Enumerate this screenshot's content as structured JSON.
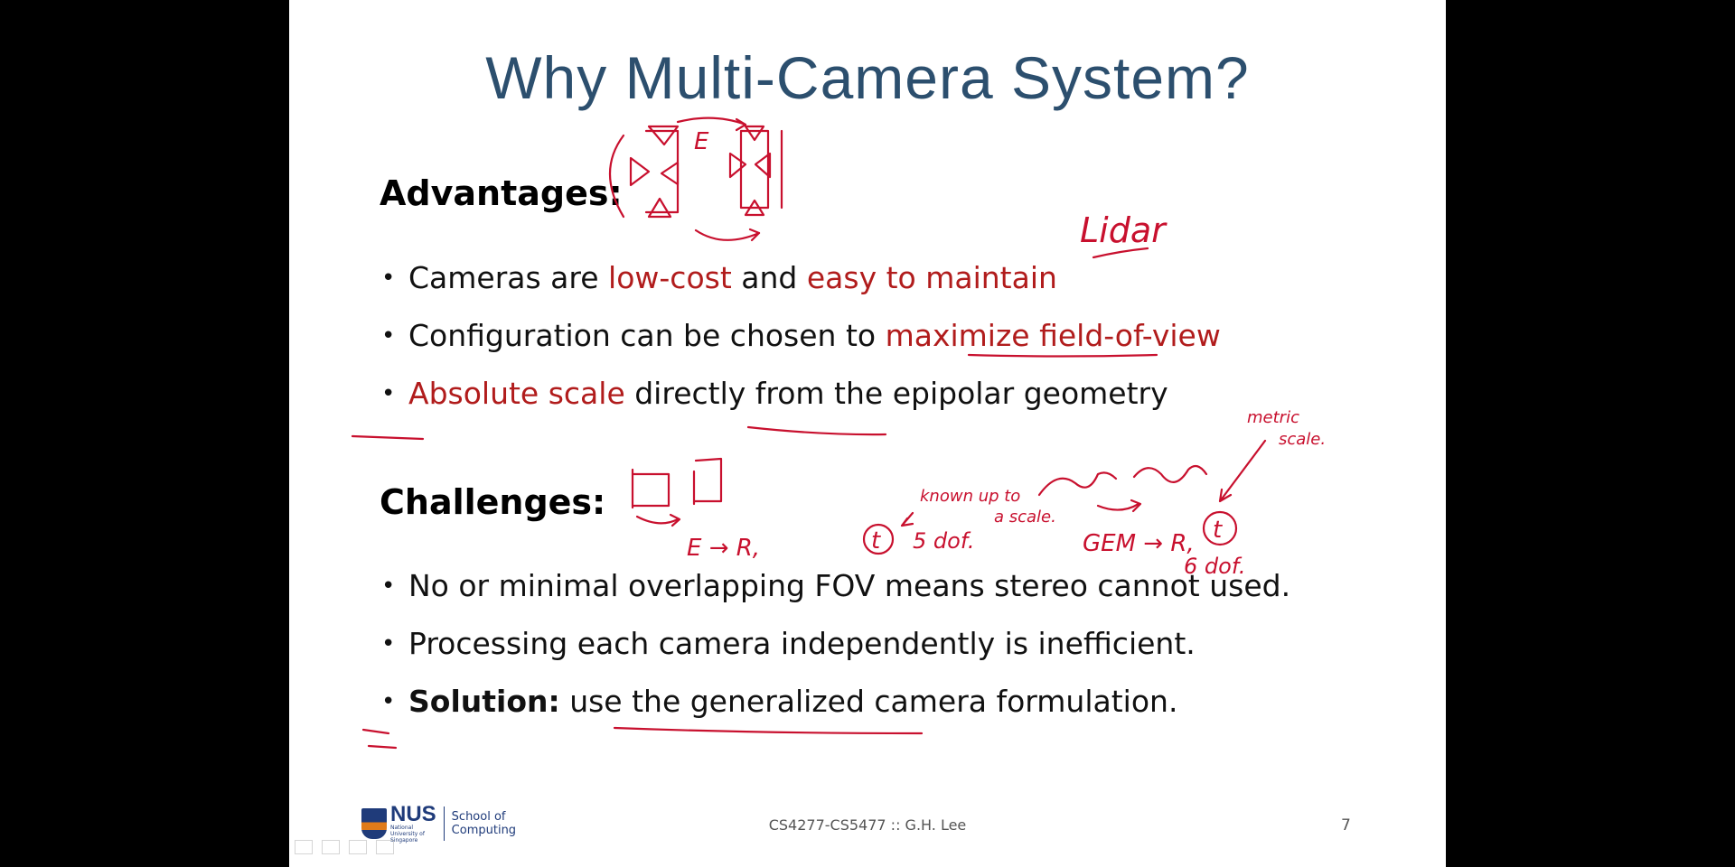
{
  "slide": {
    "title": "Why Multi-Camera System?",
    "advantages_heading": "Advantages:",
    "advantages": [
      {
        "parts": [
          {
            "text": "Cameras are ",
            "style": "normal"
          },
          {
            "text": "low-cost",
            "style": "red"
          },
          {
            "text": " and ",
            "style": "normal"
          },
          {
            "text": "easy to maintain",
            "style": "red"
          }
        ]
      },
      {
        "parts": [
          {
            "text": "Configuration can be chosen to ",
            "style": "normal"
          },
          {
            "text": "maximize field-of-view",
            "style": "red"
          }
        ]
      },
      {
        "parts": [
          {
            "text": "Absolute scale",
            "style": "red"
          },
          {
            "text": " directly from the epipolar geometry",
            "style": "normal"
          }
        ]
      }
    ],
    "challenges_heading": "Challenges:",
    "challenges": [
      {
        "parts": [
          {
            "text": "No or minimal overlapping FOV means stereo cannot used.",
            "style": "normal"
          }
        ]
      },
      {
        "parts": [
          {
            "text": "Processing each camera independently is inefficient.",
            "style": "normal"
          }
        ]
      },
      {
        "parts": [
          {
            "text": "Solution:",
            "style": "bold"
          },
          {
            "text": " use the generalized camera formulation.",
            "style": "normal"
          }
        ]
      }
    ],
    "footer": {
      "logo_name": "NUS",
      "logo_subtitle": "National University of Singapore",
      "school": "School of Computing",
      "course": "CS4277-CS5477 :: G.H. Lee",
      "page_number": "7"
    },
    "annotations": {
      "lidar": "Lidar",
      "E_label": "E",
      "E_to_Rt": "E → R,",
      "t_circled": "t",
      "five_dof": "5 dof.",
      "known_up_to": "known up to",
      "a_scale": "a scale.",
      "GEM_to_R": "GEM → R,",
      "six_dof": "6 dof.",
      "metric": "metric",
      "scale": "scale."
    }
  },
  "colors": {
    "title": "#2c4f6e",
    "highlight_red": "#b11c1c",
    "ink": "#c8102e",
    "background": "#000000"
  }
}
